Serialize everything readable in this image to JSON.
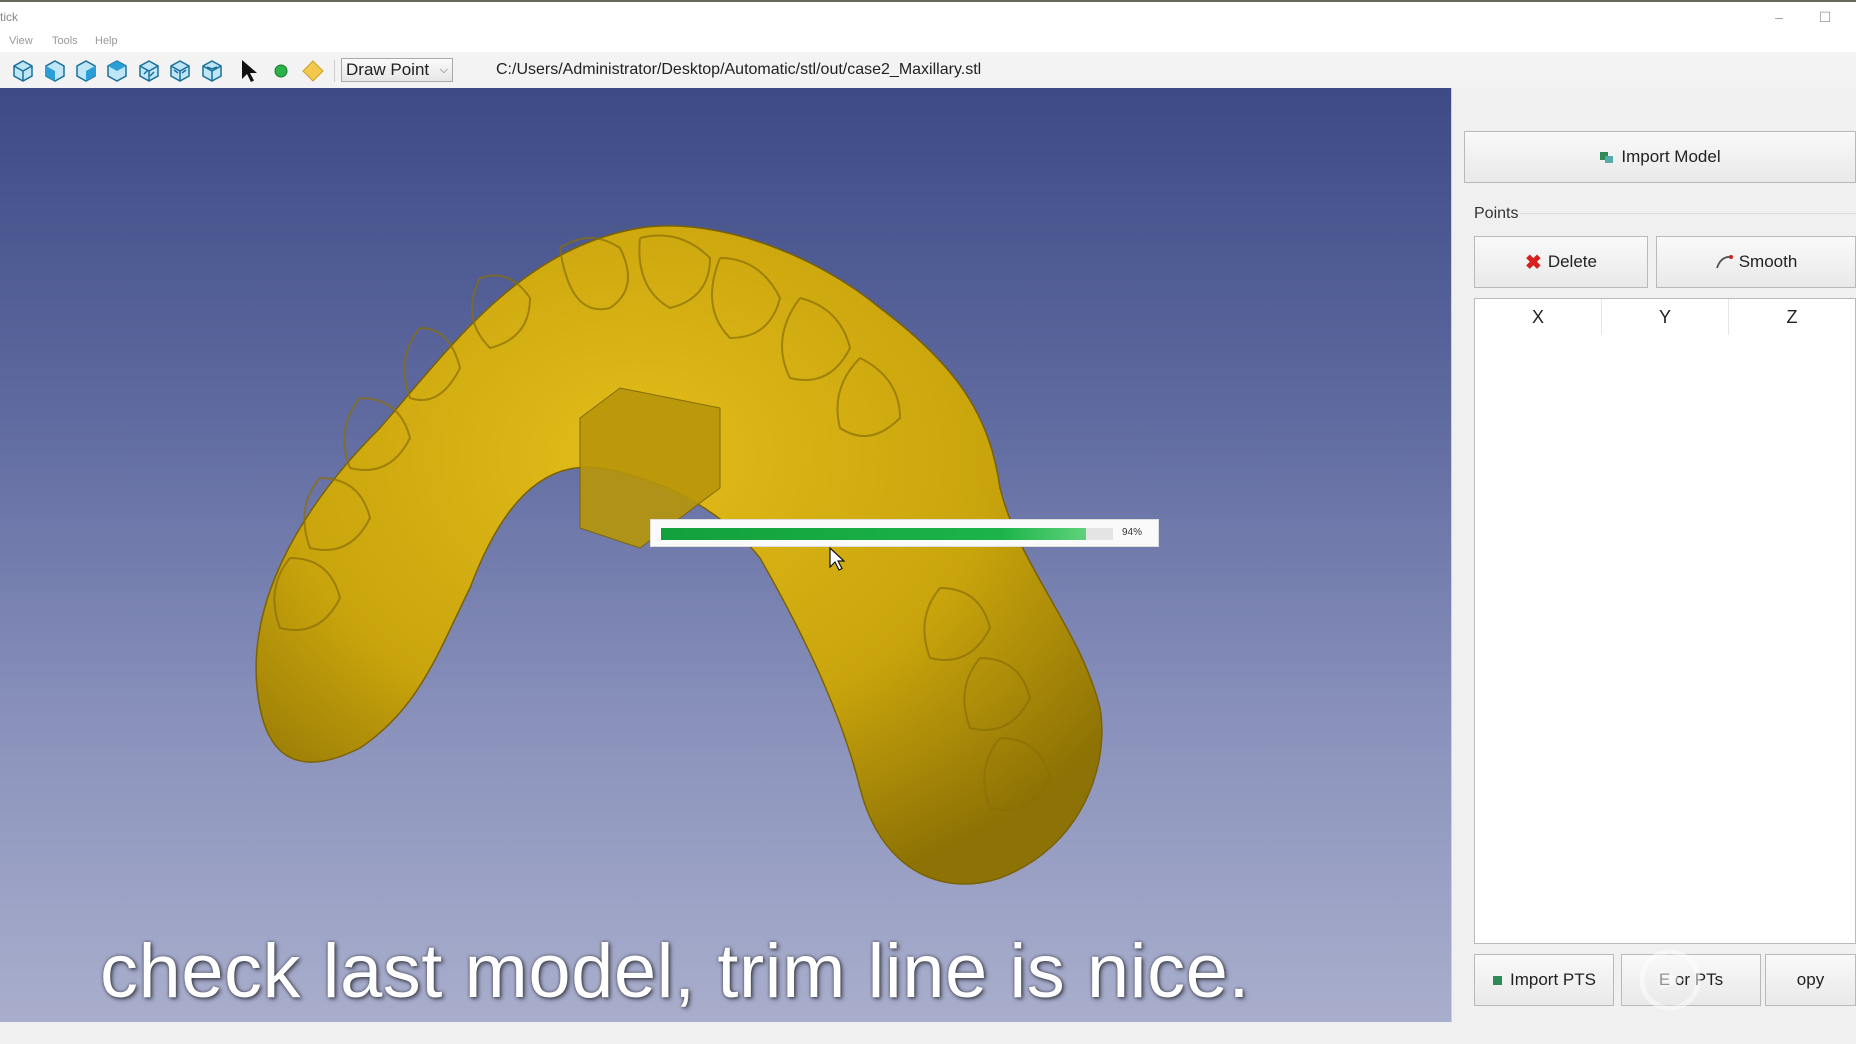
{
  "window": {
    "title": "tick"
  },
  "menu": [
    "View",
    "Tools",
    "Help"
  ],
  "toolbar": {
    "view_icons": [
      "iso-view-icon",
      "front-view-icon",
      "back-view-icon",
      "left-view-icon",
      "right-view-icon",
      "top-view-icon",
      "bottom-view-icon"
    ],
    "tools": [
      "select-arrow-icon",
      "green-point-icon",
      "yellow-diamond-icon"
    ],
    "mode": "Draw Point",
    "path": "C:/Users/Administrator/Desktop/Automatic/stl/out/case2_Maxillary.stl"
  },
  "viewport": {
    "model_color": "#c9a40c",
    "progress": {
      "value": 94,
      "label": "94%"
    },
    "subtitle": "check last model, trim line is nice."
  },
  "panel": {
    "import_model": "Import Model",
    "points_label": "Points",
    "delete": "Delete",
    "smooth": "Smooth",
    "columns": [
      "X",
      "Y",
      "Z"
    ],
    "import_pts": "Import PTS",
    "export_pts": "E  or PTs",
    "copy": "opy"
  }
}
